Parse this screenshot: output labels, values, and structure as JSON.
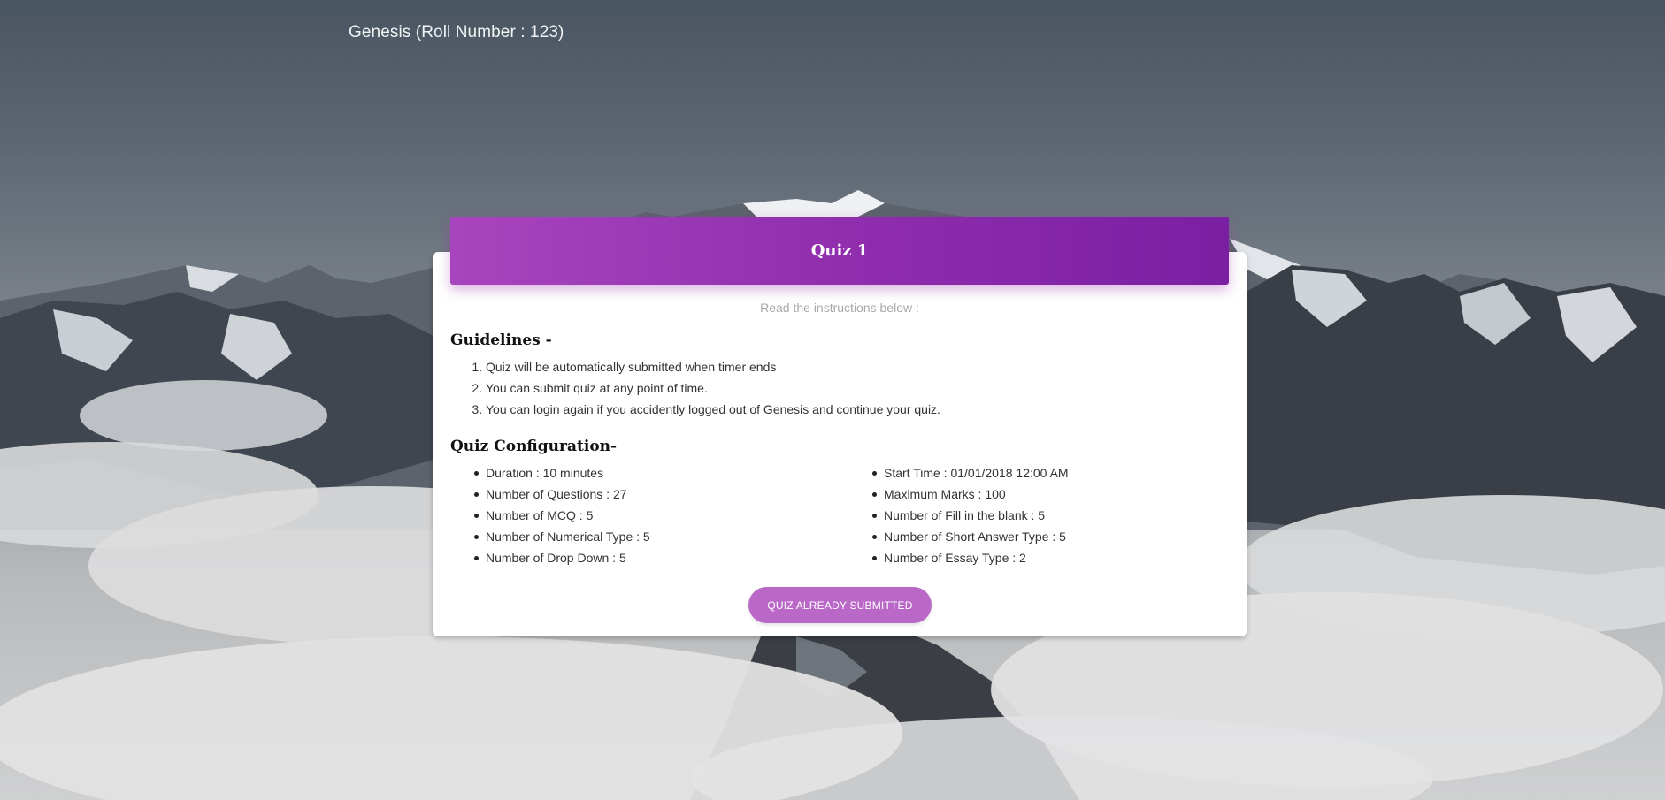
{
  "header": {
    "user_label": "Genesis (Roll Number : 123)"
  },
  "quiz": {
    "title": "Quiz 1",
    "subtitle": "Read the instructions below :",
    "guidelines_title": "Guidelines -",
    "guidelines": [
      "Quiz will be automatically submitted when timer ends",
      "You can submit quiz at any point of time.",
      "You can login again if you accidently logged out of Genesis and continue your quiz."
    ],
    "config_title": "Quiz Configuration-",
    "config_left": [
      "Duration : 10 minutes",
      "Number of Questions : 27",
      "Number of MCQ : 5",
      "Number of Numerical Type : 5",
      "Number of Drop Down : 5"
    ],
    "config_right": [
      "Start Time : 01/01/2018 12:00 AM",
      "Maximum Marks : 100",
      "Number of Fill in the blank : 5",
      "Number of Short Answer Type : 5",
      "Number of Essay Type : 2"
    ],
    "submit_label": "QUIZ ALREADY SUBMITTED"
  },
  "colors": {
    "header_gradient_start": "#a844bd",
    "header_gradient_end": "#7b1fa2",
    "button": "#ba68c8"
  }
}
